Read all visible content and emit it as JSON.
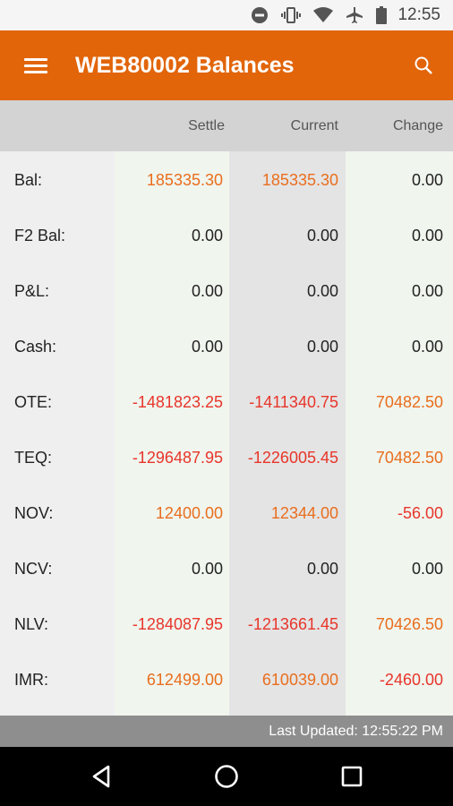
{
  "status_bar": {
    "time": "12:55",
    "icons": [
      "dnd-icon",
      "vibrate-icon",
      "wifi-icon",
      "airplane-icon",
      "battery-icon"
    ]
  },
  "app_bar": {
    "title": "WEB80002 Balances",
    "menu_icon": "hamburger-menu-icon",
    "search_icon": "search-icon",
    "color": "#e2650a"
  },
  "columns": {
    "settle": "Settle",
    "current": "Current",
    "change": "Change"
  },
  "rows": [
    {
      "label": "Bal:",
      "settle": "185335.30",
      "current": "185335.30",
      "change": "0.00"
    },
    {
      "label": "F2 Bal:",
      "settle": "0.00",
      "current": "0.00",
      "change": "0.00"
    },
    {
      "label": "P&L:",
      "settle": "0.00",
      "current": "0.00",
      "change": "0.00"
    },
    {
      "label": "Cash:",
      "settle": "0.00",
      "current": "0.00",
      "change": "0.00"
    },
    {
      "label": "OTE:",
      "settle": "-1481823.25",
      "current": "-1411340.75",
      "change": "70482.50"
    },
    {
      "label": "TEQ:",
      "settle": "-1296487.95",
      "current": "-1226005.45",
      "change": "70482.50"
    },
    {
      "label": "NOV:",
      "settle": "12400.00",
      "current": "12344.00",
      "change": "-56.00"
    },
    {
      "label": "NCV:",
      "settle": "0.00",
      "current": "0.00",
      "change": "0.00"
    },
    {
      "label": "NLV:",
      "settle": "-1284087.95",
      "current": "-1213661.45",
      "change": "70426.50"
    },
    {
      "label": "IMR:",
      "settle": "612499.00",
      "current": "610039.00",
      "change": "-2460.00"
    }
  ],
  "colors": {
    "positive": "#e96e1e",
    "zero": "#222222",
    "negative": "#e8352a"
  },
  "footer": {
    "last_updated": "Last Updated: 12:55:22 PM"
  },
  "nav_bar": {
    "buttons": [
      "back-icon",
      "home-icon",
      "recents-icon"
    ]
  }
}
